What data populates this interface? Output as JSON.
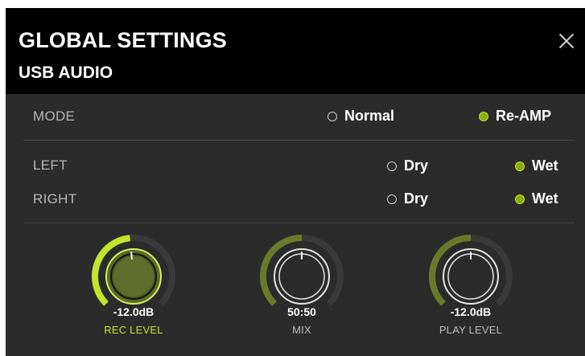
{
  "header": {
    "title": "GLOBAL SETTINGS",
    "subtitle": "USB AUDIO",
    "close_icon": "close-icon"
  },
  "mode": {
    "label": "MODE",
    "options": [
      {
        "label": "Normal",
        "selected": false
      },
      {
        "label": "Re-AMP",
        "selected": true
      }
    ]
  },
  "left": {
    "label": "LEFT",
    "options": [
      {
        "label": "Dry",
        "selected": false
      },
      {
        "label": "Wet",
        "selected": true
      }
    ]
  },
  "right": {
    "label": "RIGHT",
    "options": [
      {
        "label": "Dry",
        "selected": false
      },
      {
        "label": "Wet",
        "selected": true
      }
    ]
  },
  "knobs": [
    {
      "id": "rec-level",
      "value_text": "-12.0dB",
      "label": "REC LEVEL",
      "level": 0.48,
      "active": true
    },
    {
      "id": "mix",
      "value_text": "50:50",
      "label": "MIX",
      "level": 0.5,
      "active": false
    },
    {
      "id": "play-level",
      "value_text": "-12.0dB",
      "label": "PLAY LEVEL",
      "level": 0.5,
      "active": false
    }
  ],
  "colors": {
    "accent": "#c4e42a",
    "accent_dim": "#6a7a2a",
    "track": "#3a3a3a",
    "header_bg": "#000000",
    "panel_bg": "#2b2b2b"
  }
}
